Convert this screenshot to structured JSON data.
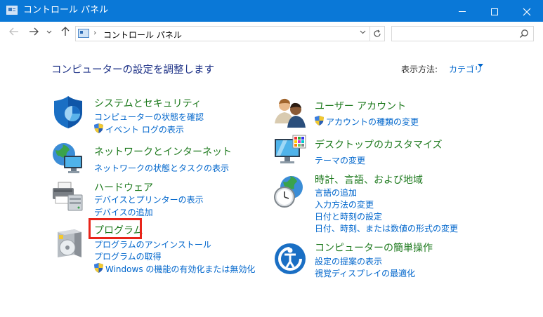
{
  "window": {
    "title": "コントロール パネル"
  },
  "address": {
    "path": "コントロール パネル",
    "separator": "›"
  },
  "search": {
    "placeholder": ""
  },
  "heading": "コンピューターの設定を調整します",
  "view_by": {
    "label": "表示方法:",
    "value": "カテゴリ"
  },
  "left_categories": [
    {
      "title": "システムとセキュリティ",
      "links": [
        "コンピューターの状態を確認",
        "イベント ログの表示"
      ]
    },
    {
      "title": "ネットワークとインターネット",
      "links": [
        "ネットワークの状態とタスクの表示"
      ]
    },
    {
      "title": "ハードウェア",
      "links": [
        "デバイスとプリンターの表示",
        "デバイスの追加"
      ]
    },
    {
      "title": "プログラム",
      "links": [
        "プログラムのアンインストール",
        "プログラムの取得",
        "Windows の機能の有効化または無効化"
      ]
    }
  ],
  "right_categories": [
    {
      "title": "ユーザー アカウント",
      "links": [
        "アカウントの種類の変更"
      ]
    },
    {
      "title": "デスクトップのカスタマイズ",
      "links": [
        "テーマの変更"
      ]
    },
    {
      "title": "時計、言語、および地域",
      "links": [
        "言語の追加",
        "入力方法の変更",
        "日付と時刻の設定",
        "日付、時刻、または数値の形式の変更"
      ]
    },
    {
      "title": "コンピューターの簡単操作",
      "links": [
        "設定の提案の表示",
        "視覚ディスプレイの最適化"
      ]
    }
  ],
  "colors": {
    "titlebar": "#0a78d7",
    "category_title": "#1e7a1e",
    "link": "#0066cc",
    "heading": "#1e3287",
    "highlight": "#e8251a"
  }
}
